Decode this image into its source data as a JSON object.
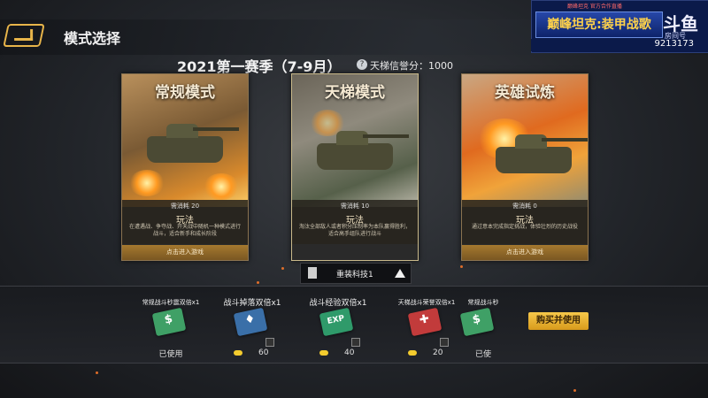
{
  "header": {
    "title": "模式选择"
  },
  "overlay": {
    "logo_small": "巅峰坦克 官方合作直播",
    "logo_title": "巅峰坦克:装甲战歌",
    "platform": "斗鱼",
    "room_label": "房间号",
    "room_number": "9213173"
  },
  "season": {
    "title": "2021第一赛季（7-9月）",
    "credit_icon": "?",
    "credit_text": "天梯信誉分：1000"
  },
  "cards": [
    {
      "name": "常规模式",
      "cost": "需消耗 20",
      "play_label": "玩法",
      "desc": "在遭遇战、争夺战、开天战中随机一种模式进行战斗，适合新手和成长阶段",
      "enter": "点击进入游戏"
    },
    {
      "name": "天梯模式",
      "cost": "需消耗 10",
      "play_label": "玩法",
      "desc": "淘汰全部敌人或者积分压制率为本队赢得胜利，适合高手组队进行战斗",
      "enter": ""
    },
    {
      "name": "英雄试炼",
      "cost": "需消耗 0",
      "play_label": "玩法",
      "desc": "通过意本完成指定挑战，体验壮烈的历史战役",
      "enter": "点击进入游戏"
    }
  ],
  "selector": {
    "label": "重装科技1"
  },
  "items": [
    {
      "name": "常规战斗秒震双倍x1",
      "glyph": "$",
      "color": "#3fa066",
      "status": "已使用"
    },
    {
      "name": "战斗掉落双倍x1",
      "glyph": "♦",
      "color": "#3a6fa8",
      "price": "60"
    },
    {
      "name": "战斗经验双倍x1",
      "glyph": "EXP",
      "color": "#2f9a6a",
      "price": "40"
    },
    {
      "name": "天梯战斗荣誉双倍x1",
      "glyph": "✚",
      "color": "#c23b3b",
      "price": "20"
    },
    {
      "name": "常规战斗秒",
      "glyph": "$",
      "color": "#3fa066",
      "status": "已使"
    }
  ],
  "buy_button": "购买并使用",
  "colors": {
    "accent": "#e8b54a",
    "button_gold": "#f6c84a",
    "card_border": "#8a7350"
  }
}
